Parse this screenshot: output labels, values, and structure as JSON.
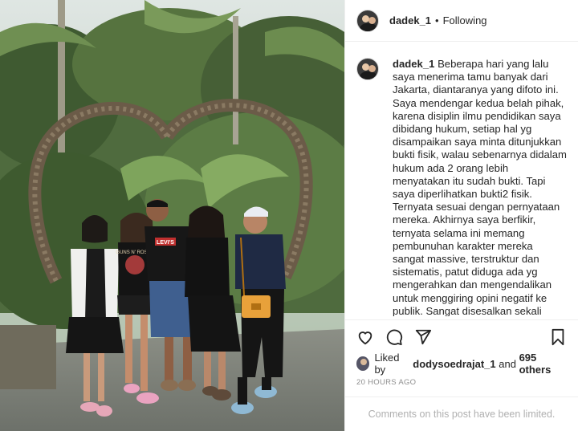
{
  "post": {
    "username": "dadek_1",
    "separator": "•",
    "follow_status": "Following",
    "caption": "Beberapa hari yang lalu saya menerima tamu banyak dari Jakarta, diantaranya yang difoto ini. Saya mendengar kedua belah pihak, karena disiplin ilmu pendidikan saya dibidang hukum, setiap hal yg disampaikan saya minta ditunjukkan bukti fisik, walau sebenarnya didalam hukum ada 2 orang lebih menyatakan itu sudah bukti. Tapi saya diperlihatkan bukti2 fisik. Ternyata sesuai dengan pernyataan mereka. Akhirnya saya berfikir, ternyata selama ini memang pembunuhan karakter mereka sangat massive, terstruktur dan sistematis, patut diduga ada yg mengerahkan dan mengendalikan untuk menggiring opini negatif ke publik. Sangat disesalkan sekali tindakan tersebut, semoga Tuhan Allah mengampuni orang yang melakukan hal",
    "likes": {
      "prefix": "Liked by",
      "user": "dodysoedrajat_1",
      "joiner": "and",
      "others": "695 others"
    },
    "timestamp": "20 HOURS AGO",
    "comments_notice": "Comments on this post have been limited."
  },
  "photo": {
    "shirt_text_1": "LEVI'S",
    "shirt_text_2": "GUNS N' ROSES"
  },
  "icons": {
    "like": "heart-icon",
    "comment": "comment-icon",
    "share": "share-icon",
    "save": "bookmark-icon"
  },
  "colors": {
    "text": "#262626",
    "muted": "#8e8e8e",
    "divider": "#efefef",
    "bag": "#e8a13a"
  }
}
